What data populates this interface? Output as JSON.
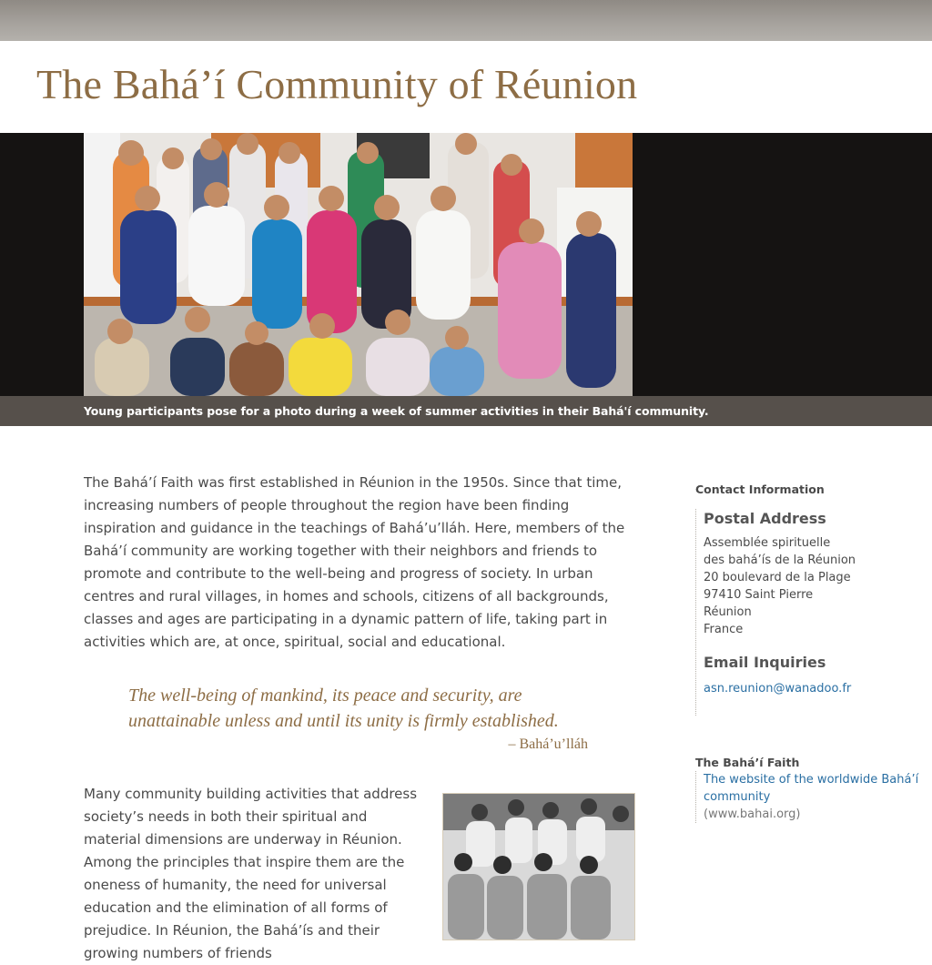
{
  "site": {
    "title": "The Bahá’í Community of Réunion"
  },
  "hero": {
    "caption": "Young participants pose for a photo during a week of summer activities in their Bahá'í community."
  },
  "content": {
    "intro": "The Bahá’í Faith was first established in Réunion in the 1950s. Since that time, increasing numbers of people throughout the region have been finding inspiration and guidance in the teachings of Bahá’u’lláh. Here, members of the Bahá’í community are working together with their neighbors and friends to promote and contribute to the well-being and progress of society. In urban centres and rural villages, in homes and schools, citizens of all backgrounds, classes and ages are participating in a dynamic pattern of life, taking part in activities which are, at once, spiritual, social and educational.",
    "quote": "The well-being of mankind, its peace and security, are unattainable unless and until its unity is firmly established.",
    "quote_author": "– Bahá’u’lláh",
    "paragraph2": "Many community building activities that address society’s needs in both their spiritual and material dimensions are underway in Réunion. Among the principles that inspire them are the oneness of humanity, the need for universal education and the elimination of all forms of prejudice. In Réunion, the Bahá’ís and their growing numbers of friends"
  },
  "sidebar": {
    "heading": "Contact Information",
    "postal_title": "Postal Address",
    "address": [
      "Assemblée spirituelle",
      "des bahá’ís de la Réunion",
      "20 boulevard de la Plage",
      "97410 Saint Pierre",
      "Réunion",
      "France"
    ],
    "email_title": "Email Inquiries",
    "email": "asn.reunion@wanadoo.fr",
    "faith_heading": "The Bahá’í Faith",
    "faith_link": "The website of the worldwide Bahá’í community",
    "faith_url": "(www.bahai.org)"
  },
  "colors": {
    "accent": "#8d6d45",
    "link": "#2a6fa3",
    "caption_bar": "#56504b",
    "hero_bg": "#151312"
  }
}
